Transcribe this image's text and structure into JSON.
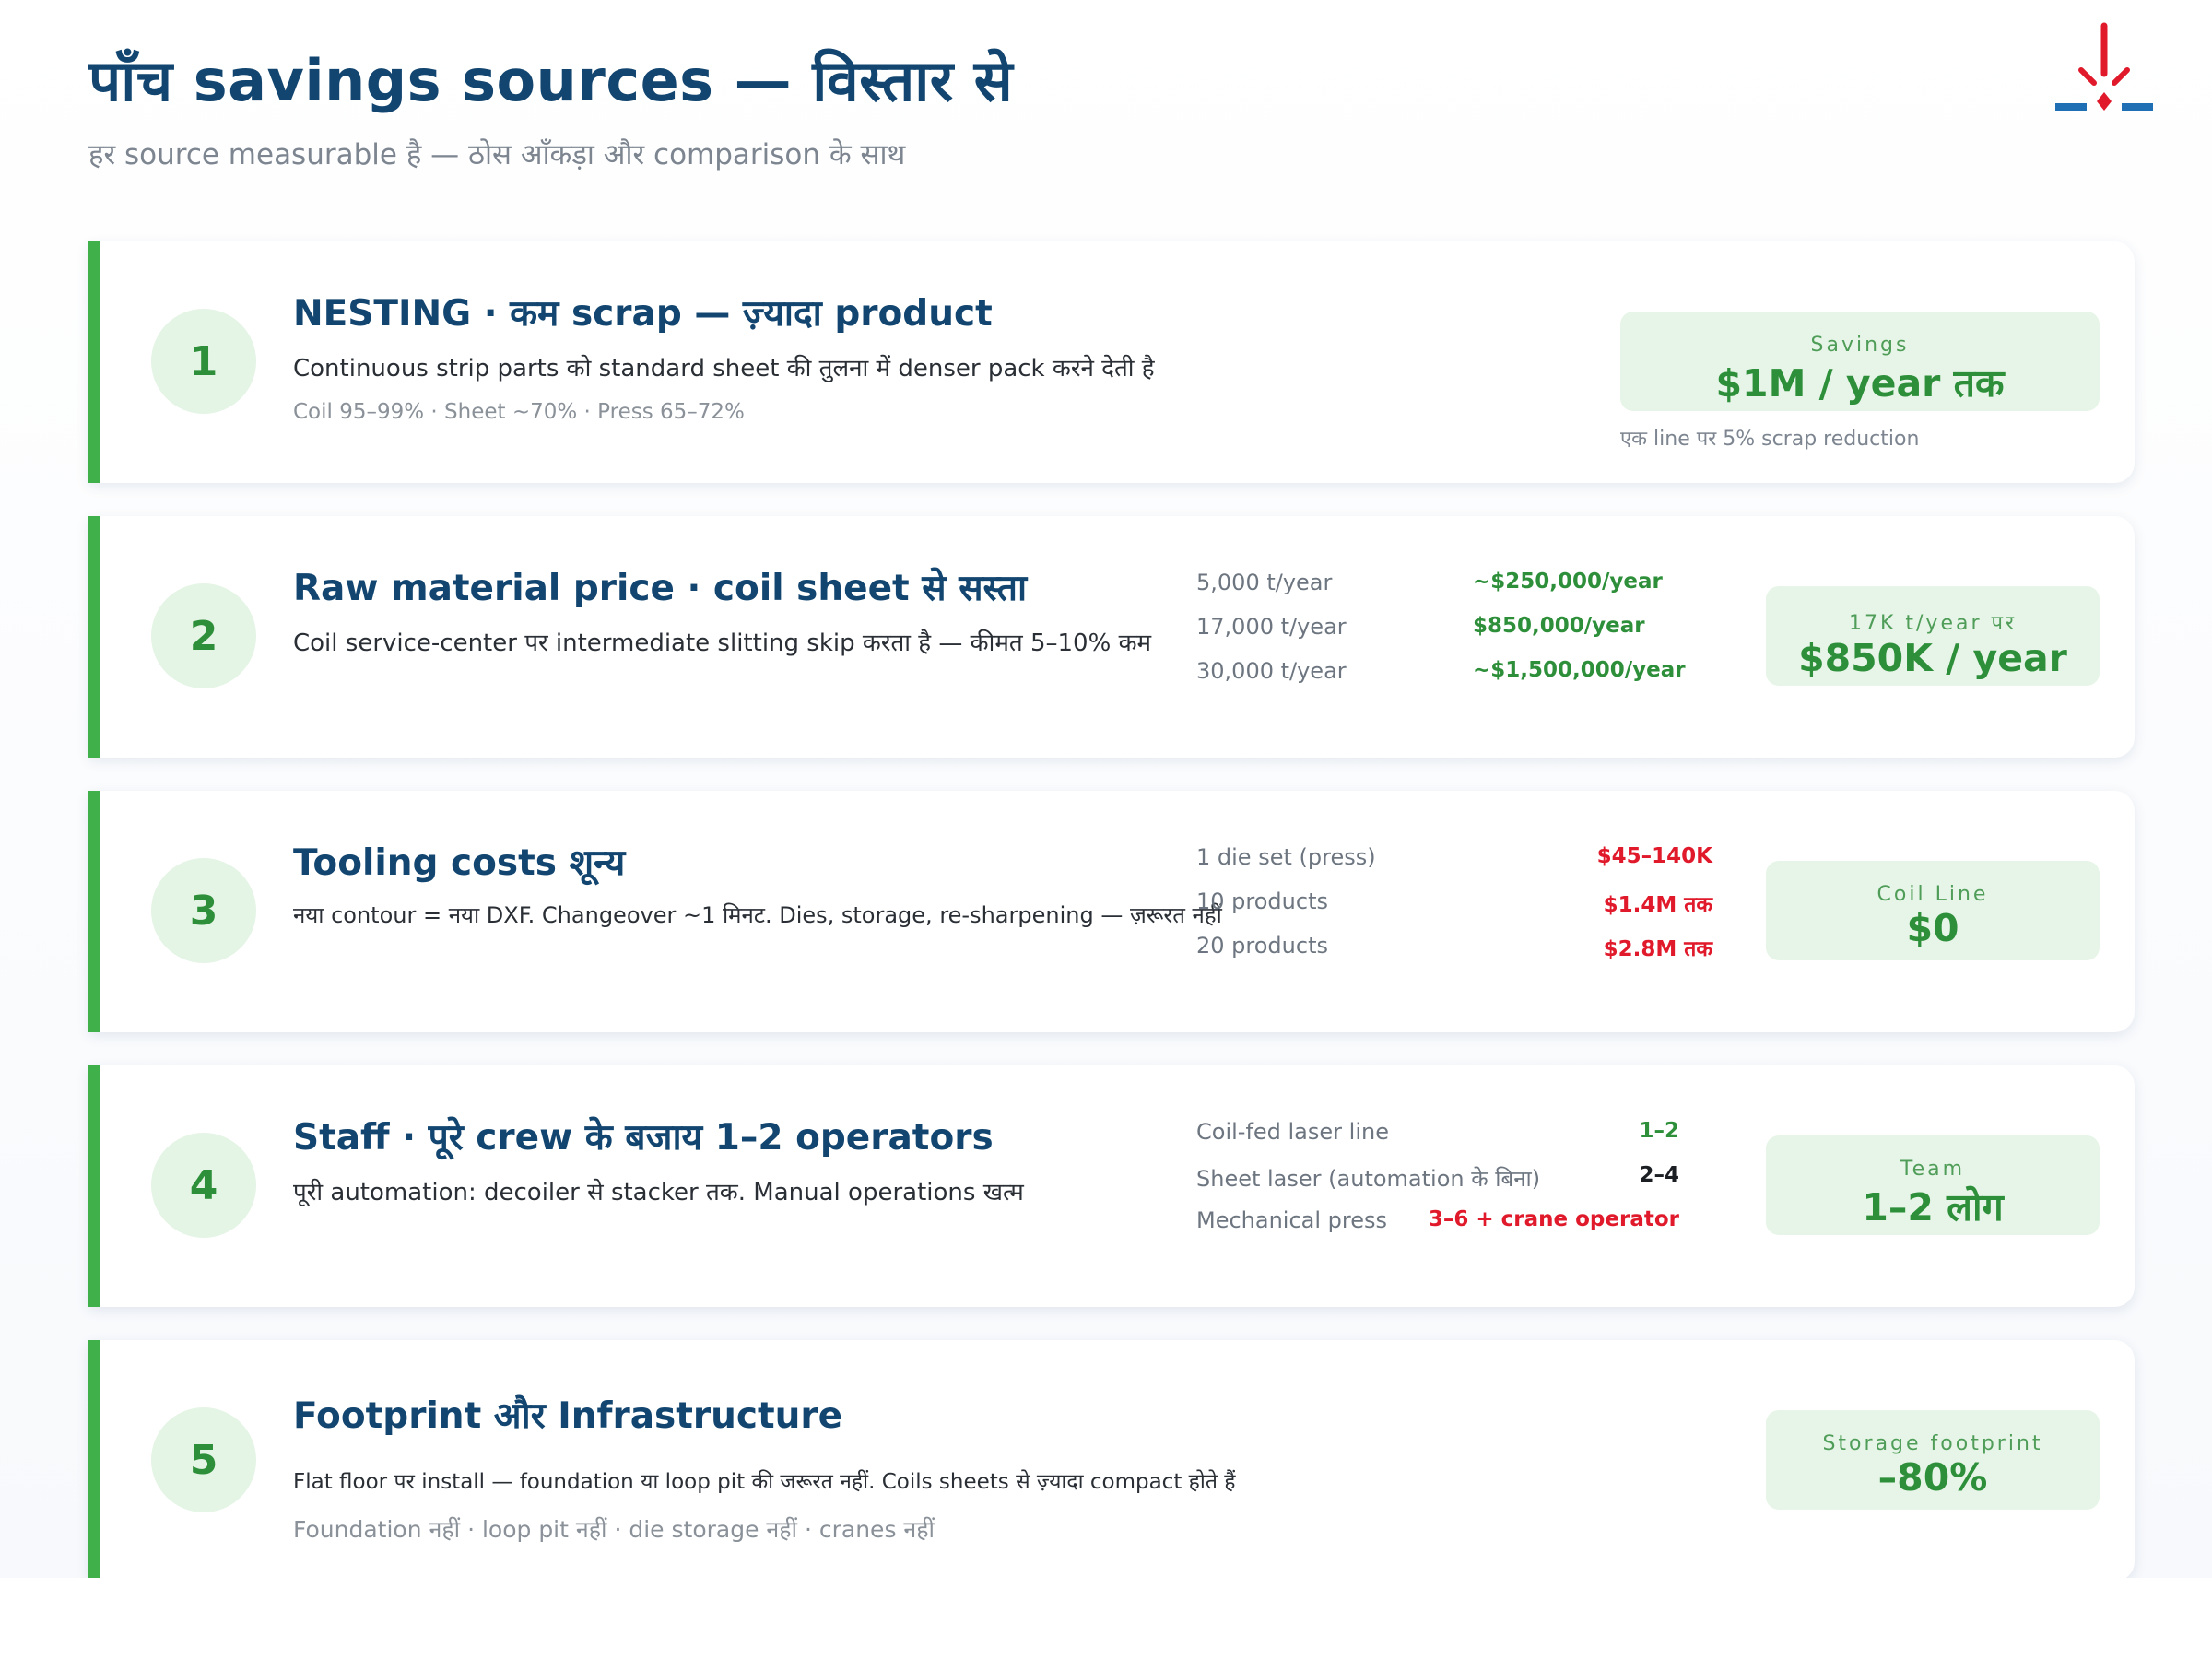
{
  "header": {
    "title": "पाँच savings sources — विस्तार से",
    "subtitle": "हर source measurable है — ठोस आँकड़ा और comparison के साथ"
  },
  "colors": {
    "accent": "#3fb04a",
    "title": "#12456f",
    "red": "#e0192b",
    "logo_red": "#e0192b",
    "logo_blue": "#1f6fb5"
  },
  "logo": {
    "icon": "spark-logo-icon"
  },
  "cards": [
    {
      "number": "1",
      "title": "NESTING · कम scrap — ज़्यादा product",
      "description": "Continuous strip parts को standard sheet की तुलना में denser pack करने देती है",
      "note": "Coil 95–99% · Sheet ~70% · Press 65–72%",
      "badge": {
        "label": "Savings",
        "value": "$1M / year तक"
      },
      "badge_note": "एक line पर 5% scrap reduction"
    },
    {
      "number": "2",
      "title": "Raw material price · coil sheet से सस्ता",
      "description": "Coil service-center पर intermediate slitting skip करता है — कीमत 5–10% कम",
      "stats": [
        {
          "label": "5,000 t/year",
          "value": "~$250,000/year",
          "tone": "green"
        },
        {
          "label": "17,000 t/year",
          "value": "$850,000/year",
          "tone": "green"
        },
        {
          "label": "30,000 t/year",
          "value": "~$1,500,000/year",
          "tone": "green"
        }
      ],
      "badge": {
        "label": "17K t/year पर",
        "value": "$850K / year"
      }
    },
    {
      "number": "3",
      "title": "Tooling costs शून्य",
      "description": "नया contour = नया DXF. Changeover ~1 मिनट. Dies, storage, re-sharpening — ज़रूरत नहीं",
      "stats": [
        {
          "label": "1 die set (press)",
          "value": "$45–140K",
          "tone": "red"
        },
        {
          "label": "10 products",
          "value": "$1.4M तक",
          "tone": "red"
        },
        {
          "label": "20 products",
          "value": "$2.8M तक",
          "tone": "red"
        }
      ],
      "badge": {
        "label": "Coil Line",
        "value": "$0"
      }
    },
    {
      "number": "4",
      "title": "Staff · पूरे crew के बजाय 1–2 operators",
      "description": "पूरी automation: decoiler से stacker तक. Manual operations खत्म",
      "stats": [
        {
          "label": "Coil-fed laser line",
          "value": "1–2",
          "tone": "green"
        },
        {
          "label": "Sheet laser (automation के बिना)",
          "value": "2–4",
          "tone": "dark"
        },
        {
          "label": "Mechanical press",
          "value": "3–6 + crane operator",
          "tone": "red"
        }
      ],
      "badge": {
        "label": "Team",
        "value": "1–2 लोग"
      }
    },
    {
      "number": "5",
      "title": "Footprint और Infrastructure",
      "description": "Flat floor पर install — foundation या loop pit की जरूरत नहीं. Coils sheets से ज़्यादा compact होते हैं",
      "note": "Foundation नहीं · loop pit नहीं · die storage नहीं · cranes नहीं",
      "badge": {
        "label": "Storage footprint",
        "value": "–80%"
      }
    }
  ]
}
